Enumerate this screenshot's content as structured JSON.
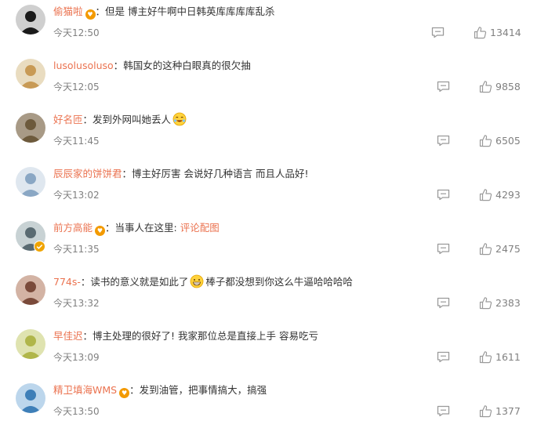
{
  "comments": [
    {
      "user": "偷猫啦",
      "medal": true,
      "verified": false,
      "text": "但是 博主好牛啊中日韩英库库库库乱杀",
      "emoji": null,
      "text2": "",
      "link": "",
      "time": "今天12:50",
      "likes": "13414",
      "avatar_color": "#1a1a1a",
      "avatar_bg": "#cfcfcf"
    },
    {
      "user": "lusolusoluso",
      "medal": false,
      "verified": false,
      "text": "韩国女的这种白眼真的很欠抽",
      "emoji": null,
      "text2": "",
      "link": "",
      "time": "今天12:05",
      "likes": "9858",
      "avatar_color": "#c89a55",
      "avatar_bg": "#e9dcc0"
    },
    {
      "user": "好名匝",
      "medal": false,
      "verified": false,
      "text": "发到外网叫她丢人",
      "emoji": "laugh-emoji",
      "text2": "",
      "link": "",
      "time": "今天11:45",
      "likes": "6505",
      "avatar_color": "#6d5a3c",
      "avatar_bg": "#a89a86"
    },
    {
      "user": "辰辰家的饼饼君",
      "medal": false,
      "verified": false,
      "text": "博主好厉害 会说好几种语言 而且人品好!",
      "emoji": null,
      "text2": "",
      "link": "",
      "time": "今天13:02",
      "likes": "4293",
      "avatar_color": "#8aa7c4",
      "avatar_bg": "#dfe7ef"
    },
    {
      "user": "前方高能",
      "medal": true,
      "verified": true,
      "text": "当事人在这里:",
      "emoji": null,
      "text2": "",
      "link": "评论配图",
      "time": "今天11:35",
      "likes": "2475",
      "avatar_color": "#5a6b72",
      "avatar_bg": "#c8d2d4"
    },
    {
      "user": "774s-",
      "medal": false,
      "verified": false,
      "text": "读书的意义就是如此了",
      "emoji": "grin-emoji",
      "text2": "棒子都没想到你这么牛逼哈哈哈哈",
      "link": "",
      "time": "今天13:32",
      "likes": "2383",
      "avatar_color": "#7a4a3a",
      "avatar_bg": "#d3b3a4"
    },
    {
      "user": "早佳迟",
      "medal": false,
      "verified": false,
      "text": "博主处理的很好了! 我家那位总是直接上手 容易吃亏",
      "emoji": null,
      "text2": "",
      "link": "",
      "time": "今天13:09",
      "likes": "1611",
      "avatar_color": "#b0b64a",
      "avatar_bg": "#dfe3b0"
    },
    {
      "user": "精卫填海WMS",
      "medal": true,
      "verified": false,
      "text": "发到油管，把事情搞大，搞强",
      "emoji": null,
      "text2": "",
      "link": "",
      "time": "今天13:50",
      "likes": "1377",
      "avatar_color": "#3e7fb8",
      "avatar_bg": "#bcd6ec"
    }
  ],
  "colors": {
    "username": "#eb7350",
    "text": "#333333",
    "meta": "#808080",
    "icon": "#9a9a9a"
  },
  "icons": {
    "reply": "comment-icon",
    "like": "thumbs-up-icon"
  }
}
